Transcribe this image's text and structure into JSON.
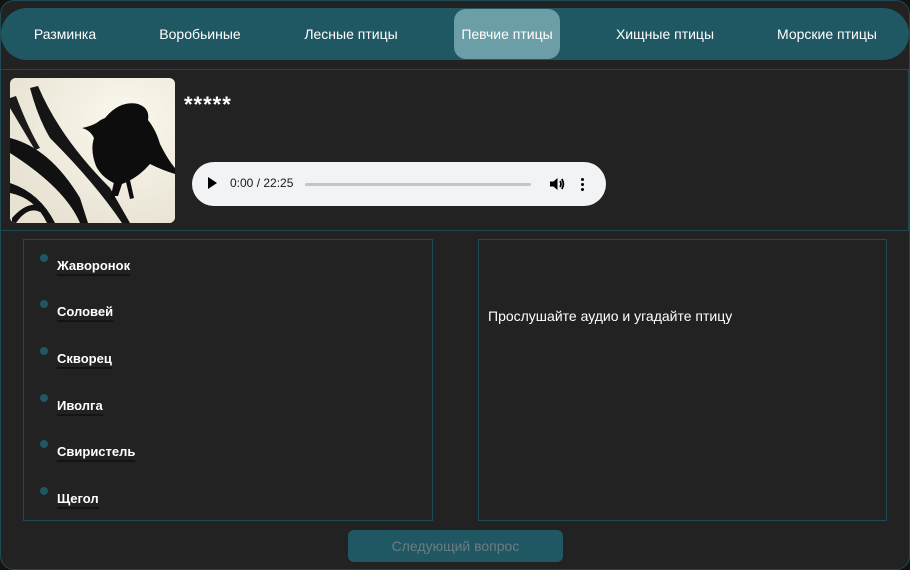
{
  "nav": {
    "items": [
      {
        "label": "Разминка"
      },
      {
        "label": "Воробьиные"
      },
      {
        "label": "Лесные птицы"
      },
      {
        "label": "Певчие птицы",
        "active": true
      },
      {
        "label": "Хищные птицы"
      },
      {
        "label": "Морские птицы"
      }
    ]
  },
  "question": {
    "hidden_name": "*****",
    "image_icon": "bird-silhouette-icon",
    "audio": {
      "time": "0:00 / 22:25",
      "progress": 0,
      "play_icon": "play-icon",
      "volume_icon": "volume-icon",
      "menu_icon": "more-vertical-icon"
    }
  },
  "answers": [
    {
      "label": "Жаворонок"
    },
    {
      "label": "Соловей"
    },
    {
      "label": "Скворец"
    },
    {
      "label": "Иволга"
    },
    {
      "label": "Свиристель"
    },
    {
      "label": "Щегол"
    }
  ],
  "details": {
    "hint": "Прослушайте аудио и угадайте птицу"
  },
  "next_button": {
    "label": "Следующий вопрос"
  },
  "colors": {
    "background": "#222222",
    "nav": "#1f5763",
    "nav_active": "#6b9ea7",
    "border": "#1e4a55",
    "disabled_text": "#6c7e82"
  }
}
